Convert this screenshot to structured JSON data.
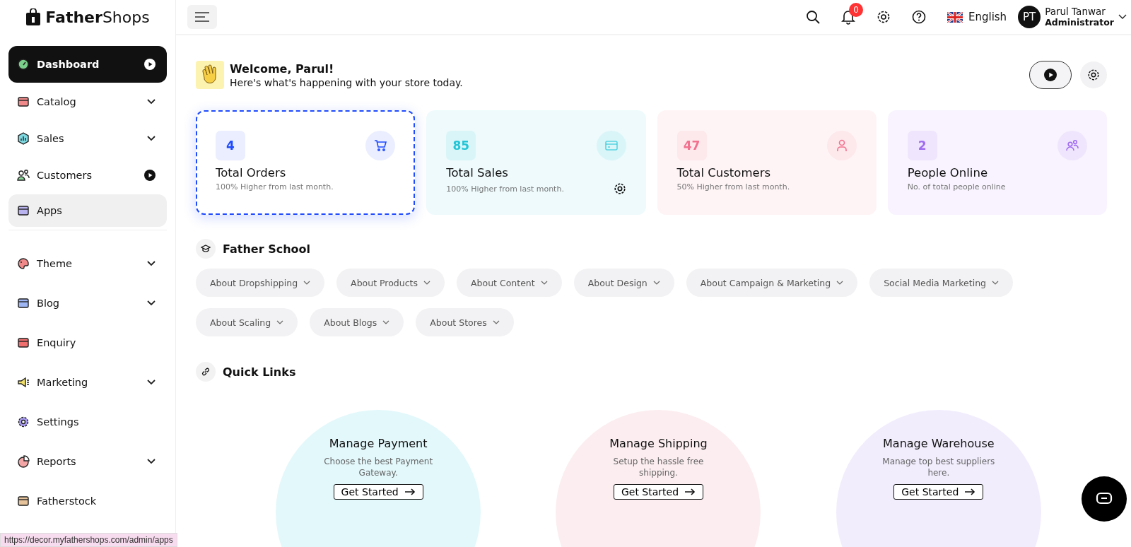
{
  "brand": {
    "name_bold": "Father",
    "name_light": "Shops"
  },
  "sidebar": {
    "groups": [
      [
        {
          "label": "Dashboard",
          "kind": "play",
          "selected": true,
          "highlighted": false
        },
        {
          "label": "Catalog",
          "kind": "expand",
          "selected": false,
          "highlighted": false
        },
        {
          "label": "Sales",
          "kind": "expand",
          "selected": false,
          "highlighted": false
        },
        {
          "label": "Customers",
          "kind": "play",
          "selected": false,
          "highlighted": false
        },
        {
          "label": "Apps",
          "kind": "plain",
          "selected": false,
          "highlighted": true
        }
      ],
      [
        {
          "label": "Theme",
          "kind": "expand",
          "selected": false,
          "highlighted": false
        },
        {
          "label": "Blog",
          "kind": "expand",
          "selected": false,
          "highlighted": false
        },
        {
          "label": "Enquiry",
          "kind": "plain",
          "selected": false,
          "highlighted": false
        },
        {
          "label": "Marketing",
          "kind": "expand",
          "selected": false,
          "highlighted": false
        },
        {
          "label": "Settings",
          "kind": "plain",
          "selected": false,
          "highlighted": false
        },
        {
          "label": "Reports",
          "kind": "expand",
          "selected": false,
          "highlighted": false
        },
        {
          "label": "Fatherstock",
          "kind": "plain",
          "selected": false,
          "highlighted": false
        }
      ]
    ]
  },
  "header": {
    "notification_count": "0",
    "language": "English",
    "user": {
      "initials": "PT",
      "name": "Parul Tanwar",
      "role": "Administrator"
    }
  },
  "welcome": {
    "title": "Welcome, Parul!",
    "subtitle": "Here's what's happening with your store today."
  },
  "stats": [
    {
      "value": "4",
      "label": "Total Orders",
      "note": "100% Higher from last month.",
      "color": "#1e4bff",
      "focused": true,
      "settings": false
    },
    {
      "value": "85",
      "label": "Total Sales",
      "note": "100% Higher from last month.",
      "color": "#22c5d6",
      "focused": false,
      "settings": true
    },
    {
      "value": "47",
      "label": "Total Customers",
      "note": "50% Higher from last month.",
      "color": "#f2718f",
      "focused": false,
      "settings": false
    },
    {
      "value": "2",
      "label": "People Online",
      "note": "No. of total people online",
      "color": "#a06bf0",
      "focused": false,
      "settings": false
    }
  ],
  "school": {
    "title": "Father School",
    "topics": [
      "About Dropshipping",
      "About Products",
      "About Content",
      "About Design",
      "About Campaign & Marketing",
      "Social Media Marketing",
      "About Scaling",
      "About Blogs",
      "About Stores"
    ]
  },
  "quick_links": {
    "title": "Quick Links",
    "items": [
      {
        "title": "Manage Payment",
        "text": "Choose the best Payment Gateway.",
        "button": "Get Started",
        "color": "#e3f8fb"
      },
      {
        "title": "Manage Shipping",
        "text": "Setup the hassle free shipping.",
        "button": "Get Started",
        "color": "#fcedf0"
      },
      {
        "title": "Manage Warehouse",
        "text": "Manage top best suppliers here.",
        "button": "Get Started",
        "color": "#f2edfd"
      }
    ]
  },
  "status_bar": {
    "url": "https://decor.myfathershops.com/admin/apps"
  }
}
